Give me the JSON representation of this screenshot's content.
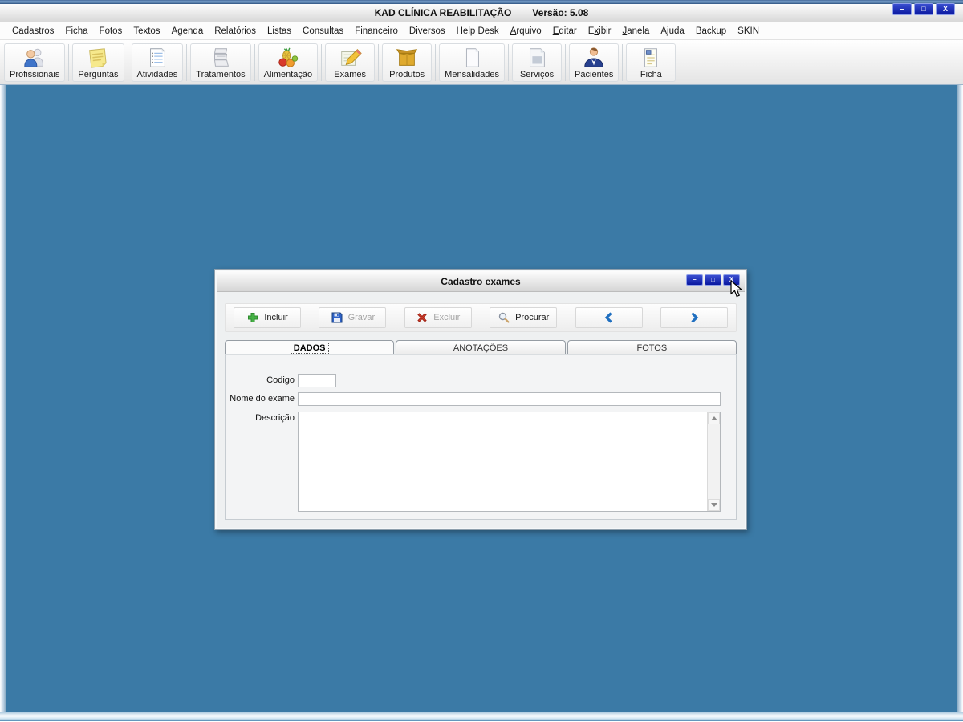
{
  "window": {
    "title": "KAD CLÍNICA REABILITAÇÃO",
    "version": "Versão: 5.08",
    "controls": [
      {
        "name": "minimize-button",
        "glyph": "–"
      },
      {
        "name": "maximize-button",
        "glyph": "□"
      },
      {
        "name": "close-button",
        "glyph": "X"
      }
    ]
  },
  "menubar": {
    "items": [
      {
        "label": "Cadastros"
      },
      {
        "label": "Ficha"
      },
      {
        "label": "Fotos"
      },
      {
        "label": "Textos"
      },
      {
        "label": "Agenda"
      },
      {
        "label": "Relatórios"
      },
      {
        "label": "Listas"
      },
      {
        "label": "Consultas"
      },
      {
        "label": "Financeiro"
      },
      {
        "label": "Diversos"
      },
      {
        "label": "Help Desk"
      },
      {
        "label": "Arquivo",
        "accel": 0
      },
      {
        "label": "Editar",
        "accel": 0
      },
      {
        "label": "Exibir",
        "accel": 1
      },
      {
        "label": "Janela",
        "accel": 0
      },
      {
        "label": "Ajuda"
      },
      {
        "label": "Backup"
      },
      {
        "label": "SKIN"
      }
    ]
  },
  "toolbar": {
    "items": [
      {
        "label": "Profissionais",
        "icon": "people-icon"
      },
      {
        "label": "Perguntas",
        "icon": "sticky-note-icon"
      },
      {
        "label": "Atividades",
        "icon": "notepad-icon"
      },
      {
        "label": "Tratamentos",
        "icon": "paper-stack-icon"
      },
      {
        "label": "Alimentação",
        "icon": "fruits-icon"
      },
      {
        "label": "Exames",
        "icon": "exam-pencil-icon"
      },
      {
        "label": "Produtos",
        "icon": "box-icon"
      },
      {
        "label": "Mensalidades",
        "icon": "sheet-icon"
      },
      {
        "label": "Serviços",
        "icon": "service-doc-icon"
      },
      {
        "label": "Pacientes",
        "icon": "patient-icon"
      },
      {
        "label": "Ficha",
        "icon": "record-file-icon"
      }
    ]
  },
  "dialog": {
    "title": "Cadastro exames",
    "controls": [
      {
        "name": "dialog-minimize-button",
        "glyph": "–"
      },
      {
        "name": "dialog-maximize-button",
        "glyph": "□"
      },
      {
        "name": "dialog-close-button",
        "glyph": "X"
      }
    ],
    "toolbar": [
      {
        "name": "incluir-button",
        "label": "Incluir",
        "icon": "plus-icon",
        "enabled": true
      },
      {
        "name": "gravar-button",
        "label": "Gravar",
        "icon": "floppy-icon",
        "enabled": false
      },
      {
        "name": "excluir-button",
        "label": "Excluir",
        "icon": "delete-x-icon",
        "enabled": false
      },
      {
        "name": "procurar-button",
        "label": "Procurar",
        "icon": "magnifier-icon",
        "enabled": true
      },
      {
        "name": "previous-button",
        "label": "",
        "icon": "chevron-left-icon",
        "enabled": true
      },
      {
        "name": "next-button",
        "label": "",
        "icon": "chevron-right-icon",
        "enabled": true
      }
    ],
    "tabs": [
      {
        "label": "DADOS",
        "active": true
      },
      {
        "label": "ANOTAÇÕES",
        "active": false
      },
      {
        "label": "FOTOS",
        "active": false
      }
    ],
    "form": {
      "codigo": {
        "label": "Codigo",
        "value": ""
      },
      "nome": {
        "label": "Nome do exame",
        "value": ""
      },
      "descricao": {
        "label": "Descrição",
        "value": ""
      }
    }
  },
  "colors": {
    "desktop_background": "#3B7AA6",
    "window_control_button": "#0A18A0",
    "accent_chevron_blue": "#1F6FC0",
    "incluir_green": "#45B045",
    "excluir_red": "#D23B2A",
    "gravar_blue": "#2E62C8"
  }
}
